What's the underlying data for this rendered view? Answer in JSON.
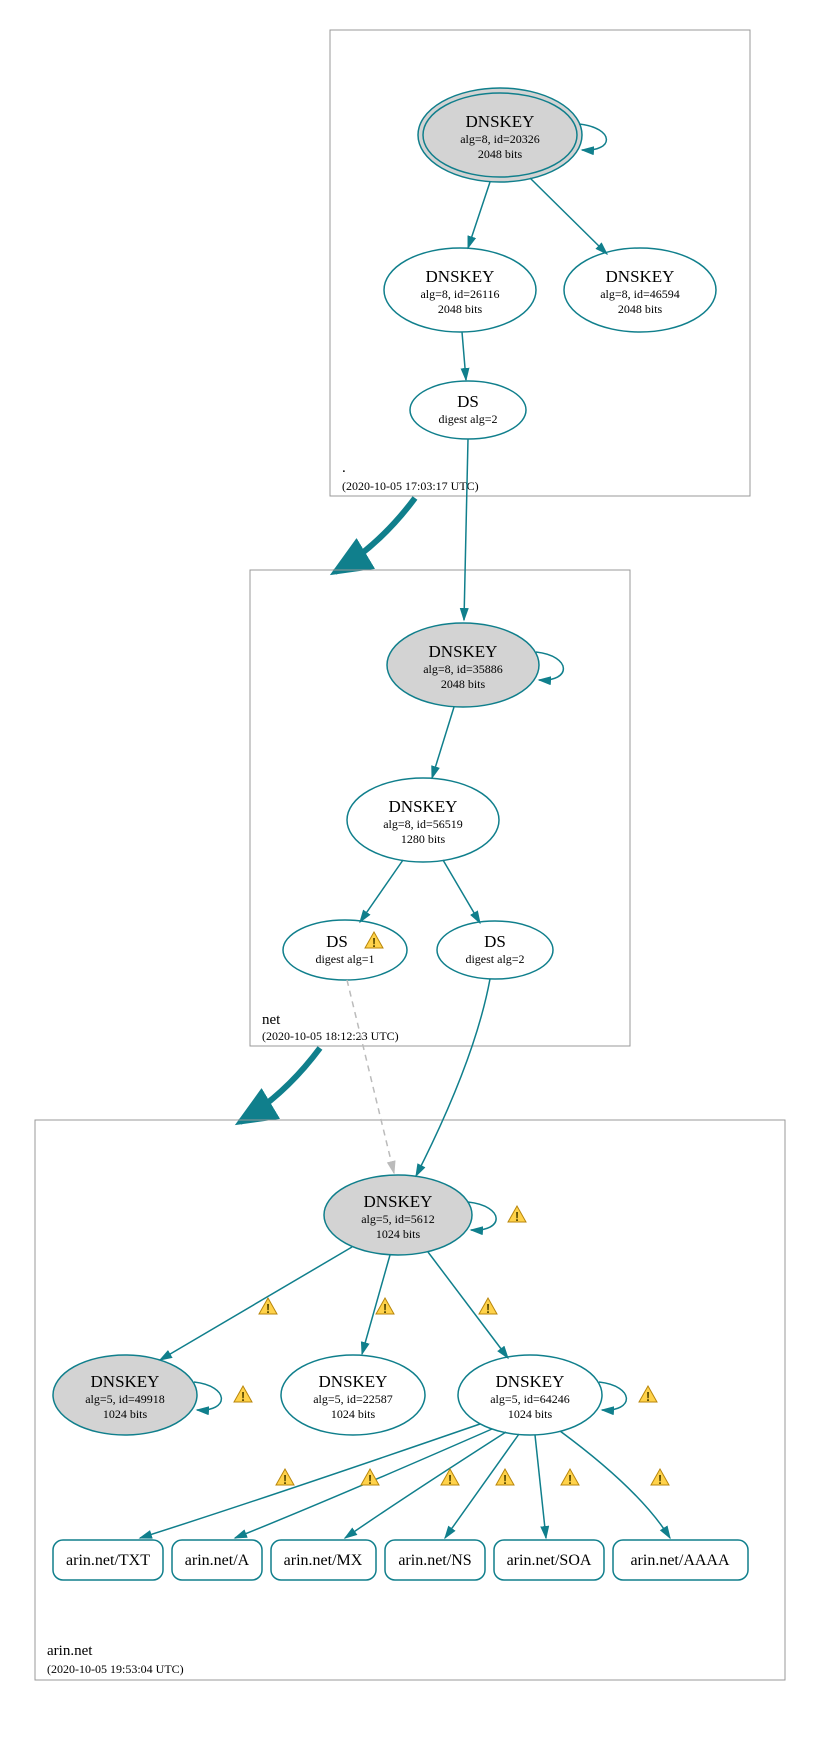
{
  "zones": {
    "root": {
      "name": ".",
      "timestamp": "(2020-10-05 17:03:17 UTC)"
    },
    "net": {
      "name": "net",
      "timestamp": "(2020-10-05 18:12:23 UTC)"
    },
    "arin": {
      "name": "arin.net",
      "timestamp": "(2020-10-05 19:53:04 UTC)"
    }
  },
  "nodes": {
    "root_ksk": {
      "title": "DNSKEY",
      "l1": "alg=8, id=20326",
      "l2": "2048 bits"
    },
    "root_zsk": {
      "title": "DNSKEY",
      "l1": "alg=8, id=26116",
      "l2": "2048 bits"
    },
    "root_dnskey3": {
      "title": "DNSKEY",
      "l1": "alg=8, id=46594",
      "l2": "2048 bits"
    },
    "root_ds": {
      "title": "DS",
      "l1": "digest alg=2"
    },
    "net_ksk": {
      "title": "DNSKEY",
      "l1": "alg=8, id=35886",
      "l2": "2048 bits"
    },
    "net_zsk": {
      "title": "DNSKEY",
      "l1": "alg=8, id=56519",
      "l2": "1280 bits"
    },
    "net_ds1": {
      "title": "DS",
      "l1": "digest alg=1"
    },
    "net_ds2": {
      "title": "DS",
      "l1": "digest alg=2"
    },
    "arin_ksk": {
      "title": "DNSKEY",
      "l1": "alg=5, id=5612",
      "l2": "1024 bits"
    },
    "arin_dnskey_49918": {
      "title": "DNSKEY",
      "l1": "alg=5, id=49918",
      "l2": "1024 bits"
    },
    "arin_dnskey_22587": {
      "title": "DNSKEY",
      "l1": "alg=5, id=22587",
      "l2": "1024 bits"
    },
    "arin_zsk": {
      "title": "DNSKEY",
      "l1": "alg=5, id=64246",
      "l2": "1024 bits"
    }
  },
  "rr": {
    "txt": "arin.net/TXT",
    "a": "arin.net/A",
    "mx": "arin.net/MX",
    "ns": "arin.net/NS",
    "soa": "arin.net/SOA",
    "aaaa": "arin.net/AAAA"
  }
}
